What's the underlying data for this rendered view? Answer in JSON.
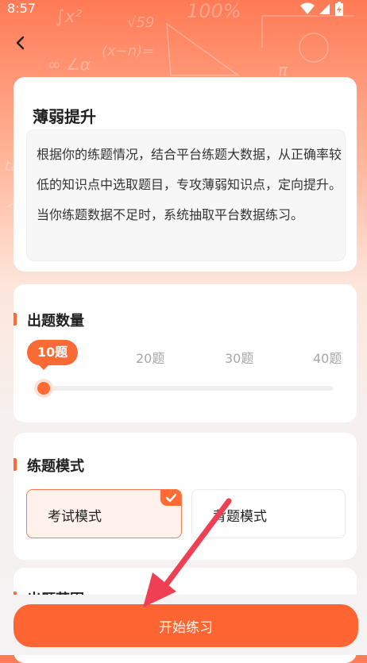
{
  "status_bar": {
    "time": "8:57"
  },
  "colors": {
    "accent": "#ff6533",
    "accent_light": "#fff1ec",
    "annotation_arrow": "#ef3f52"
  },
  "icons": {
    "back": "chevron-left-icon",
    "wifi": "wifi-icon",
    "signal": "signal-icon",
    "battery": "battery-charging-icon",
    "selected": "checkmark-icon"
  },
  "intro": {
    "title": "薄弱提升",
    "description": "根据你的练题情况，结合平台练题大数据，从正确率较低的知识点中选取题目，专攻薄弱知识点，定向提升。 当你练题数据不足时，系统抽取平台数据练习。"
  },
  "question_count": {
    "title": "出题数量",
    "options": [
      "10题",
      "20题",
      "30题",
      "40题"
    ],
    "selected": "10题"
  },
  "practice_mode": {
    "title": "练题模式",
    "options": [
      "考试模式",
      "背题模式"
    ],
    "selected": "考试模式"
  },
  "range_section": {
    "title": "出题范围"
  },
  "start_button": {
    "label": "开始练习"
  }
}
